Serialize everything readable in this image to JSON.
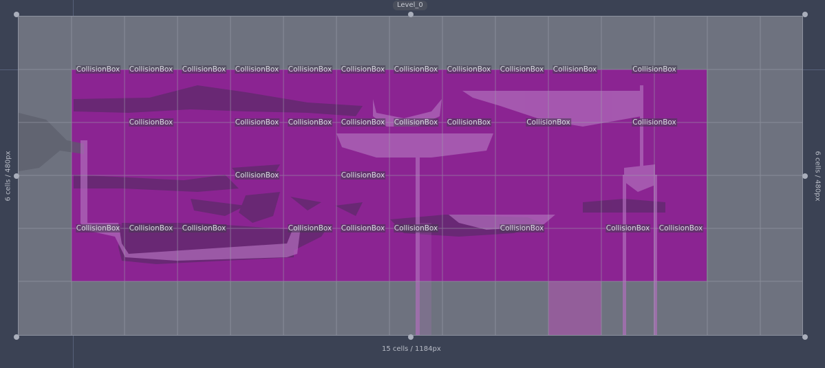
{
  "level": {
    "name": "Level_0"
  },
  "dimensions": {
    "horizontal": "15 cells / 1184px",
    "vertical_left": "6 cells / 480px",
    "vertical_right": "6 cells / 480px"
  },
  "grid": {
    "columns": 15,
    "rows": 6
  },
  "collision_label": "CollisionBox",
  "colors": {
    "collision_fill": "#8b2492",
    "level_bg": "#6e727f",
    "canvas_bg": "#3b4254",
    "tile_shadow": "#5e2a6b",
    "tile_light": "#b06ebc"
  },
  "collision_boxes": [
    {
      "col": 1,
      "row": 1,
      "w": 1,
      "h": 1
    },
    {
      "col": 2,
      "row": 1,
      "w": 1,
      "h": 1
    },
    {
      "col": 3,
      "row": 1,
      "w": 1,
      "h": 1
    },
    {
      "col": 4,
      "row": 1,
      "w": 1,
      "h": 1
    },
    {
      "col": 5,
      "row": 1,
      "w": 1,
      "h": 1
    },
    {
      "col": 6,
      "row": 1,
      "w": 1,
      "h": 1
    },
    {
      "col": 7,
      "row": 1,
      "w": 1,
      "h": 1
    },
    {
      "col": 8,
      "row": 1,
      "w": 1,
      "h": 1
    },
    {
      "col": 9,
      "row": 1,
      "w": 1,
      "h": 1
    },
    {
      "col": 10,
      "row": 1,
      "w": 1,
      "h": 1
    },
    {
      "col": 11,
      "row": 1,
      "w": 2,
      "h": 1
    },
    {
      "col": 2,
      "row": 2,
      "w": 1,
      "h": 1
    },
    {
      "col": 4,
      "row": 2,
      "w": 1,
      "h": 1
    },
    {
      "col": 5,
      "row": 2,
      "w": 1,
      "h": 1
    },
    {
      "col": 6,
      "row": 2,
      "w": 1,
      "h": 1
    },
    {
      "col": 7,
      "row": 2,
      "w": 1,
      "h": 1
    },
    {
      "col": 8,
      "row": 2,
      "w": 1,
      "h": 1
    },
    {
      "col": 9,
      "row": 2,
      "w": 2,
      "h": 1
    },
    {
      "col": 11,
      "row": 2,
      "w": 2,
      "h": 1
    },
    {
      "col": 4,
      "row": 3,
      "w": 1,
      "h": 1
    },
    {
      "col": 6,
      "row": 3,
      "w": 1,
      "h": 1
    },
    {
      "col": 1,
      "row": 4,
      "w": 1,
      "h": 1
    },
    {
      "col": 2,
      "row": 4,
      "w": 1,
      "h": 1
    },
    {
      "col": 3,
      "row": 4,
      "w": 1,
      "h": 1
    },
    {
      "col": 5,
      "row": 4,
      "w": 1,
      "h": 1
    },
    {
      "col": 6,
      "row": 4,
      "w": 1,
      "h": 1
    },
    {
      "col": 7,
      "row": 4,
      "w": 1,
      "h": 1
    },
    {
      "col": 8,
      "row": 4,
      "w": 3,
      "h": 1
    },
    {
      "col": 11,
      "row": 4,
      "w": 1,
      "h": 1
    },
    {
      "col": 12,
      "row": 4,
      "w": 1,
      "h": 1
    }
  ]
}
